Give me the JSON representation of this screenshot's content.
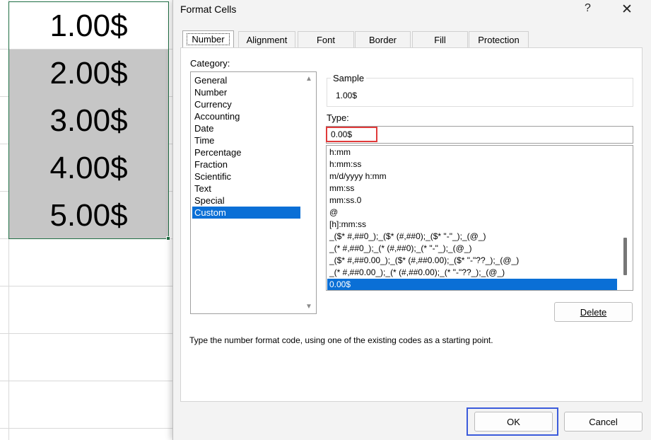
{
  "sheet": {
    "cells": [
      "1.00$",
      "2.00$",
      "3.00$",
      "4.00$",
      "5.00$"
    ]
  },
  "dialog": {
    "title": "Format Cells",
    "help_glyph": "?",
    "close_glyph": "✕",
    "tabs": [
      "Number",
      "Alignment",
      "Font",
      "Border",
      "Fill",
      "Protection"
    ],
    "category_label": "Category:",
    "categories": [
      "General",
      "Number",
      "Currency",
      "Accounting",
      "Date",
      "Time",
      "Percentage",
      "Fraction",
      "Scientific",
      "Text",
      "Special",
      "Custom"
    ],
    "selected_category": "Custom",
    "sample_label": "Sample",
    "sample_value": "1.00$",
    "type_label": "Type:",
    "type_value": "0.00$",
    "formats": [
      "h:mm",
      "h:mm:ss",
      "m/d/yyyy h:mm",
      "mm:ss",
      "mm:ss.0",
      "@",
      "[h]:mm:ss",
      "_($* #,##0_);_($* (#,##0);_($* \"-\"_);_(@_)",
      "_(* #,##0_);_(* (#,##0);_(* \"-\"_);_(@_)",
      "_($* #,##0.00_);_($* (#,##0.00);_($* \"-\"??_);_(@_)",
      "_(* #,##0.00_);_(* (#,##0.00);_(* \"-\"??_);_(@_)",
      "0.00$"
    ],
    "selected_format": "0.00$",
    "delete_label": "Delete",
    "hint": "Type the number format code, using one of the existing codes as a starting point.",
    "ok_label": "OK",
    "cancel_label": "Cancel",
    "colors": {
      "selection_blue": "#0a6fd6",
      "highlight_red": "#e03a3a",
      "highlight_blue": "#3b5bdb",
      "sheet_border": "#1e6e43"
    }
  }
}
